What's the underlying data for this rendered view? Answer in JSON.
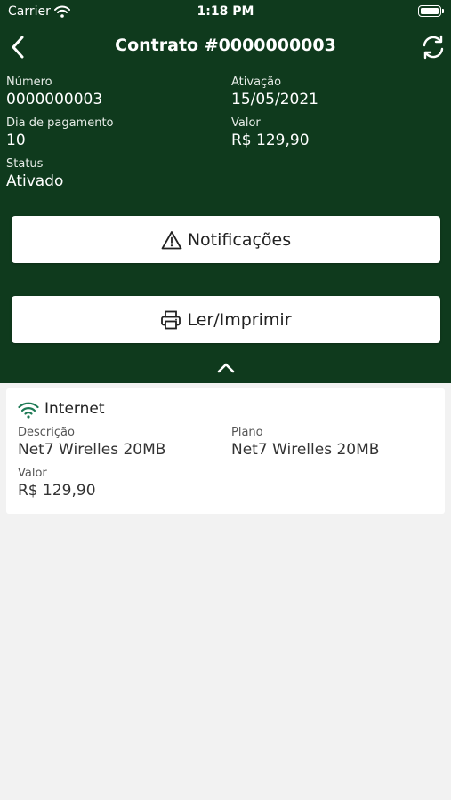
{
  "status_bar": {
    "carrier": "Carrier",
    "time": "1:18 PM"
  },
  "navbar": {
    "title": "Contrato #0000000003",
    "back_icon": "chevron-left-icon",
    "refresh_icon": "refresh-icon"
  },
  "contract": {
    "numero_label": "Número",
    "numero_value": "0000000003",
    "ativacao_label": "Ativação",
    "ativacao_value": "15/05/2021",
    "dia_label": "Dia de pagamento",
    "dia_value": "10",
    "valor_label": "Valor",
    "valor_value": "R$ 129,90",
    "status_label": "Status",
    "status_value": "Ativado"
  },
  "actions": {
    "notificacoes_label": "Notificações",
    "notificacoes_icon": "warning-icon",
    "imprimir_label": "Ler/Imprimir",
    "imprimir_icon": "printer-icon",
    "collapse_icon": "chevron-up-icon"
  },
  "service": {
    "icon": "wifi-icon",
    "title": "Internet",
    "descricao_label": "Descrição",
    "descricao_value": "Net7 Wirelles 20MB",
    "plano_label": "Plano",
    "plano_value": "Net7 Wirelles 20MB",
    "valor_label": "Valor",
    "valor_value": "R$ 129,90"
  },
  "colors": {
    "header_bg": "#0f3a1d",
    "page_bg": "#f2f2f2",
    "accent": "#1e7a55"
  }
}
